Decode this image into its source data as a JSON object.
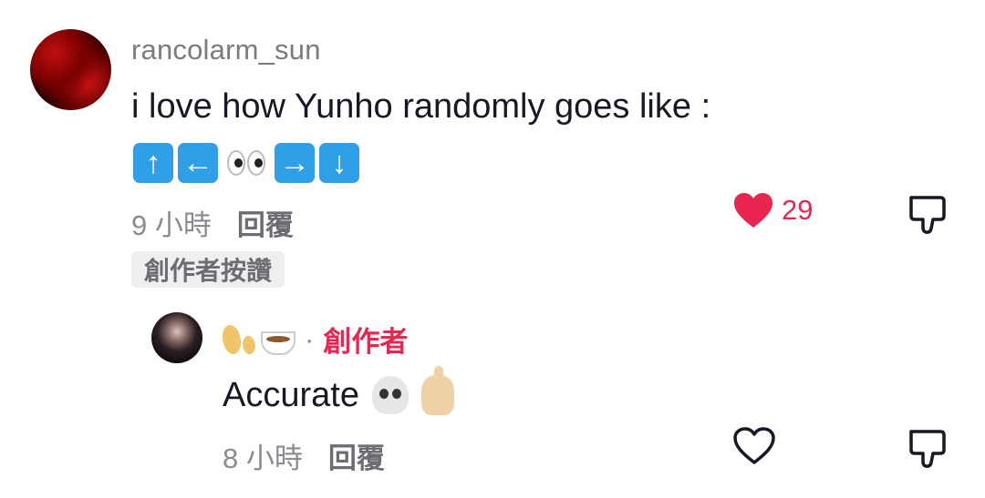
{
  "comment": {
    "username": "rancolarm_sun",
    "text": "i love how Yunho randomly goes like :",
    "emojis": [
      "up-arrow-icon",
      "left-arrow-icon",
      "eyes-icon",
      "right-arrow-icon",
      "down-arrow-icon"
    ],
    "time": "9 小時",
    "reply_label": "回覆",
    "like_count": "29",
    "liked": true,
    "creator_liked_badge": "創作者按讚"
  },
  "reply": {
    "author_emojis": [
      "leaves-icon",
      "coffee-icon"
    ],
    "separator": "·",
    "creator_tag": "創作者",
    "text": "Accurate",
    "text_emojis": [
      "skull-icon",
      "pointing-up-icon"
    ],
    "time": "8 小時",
    "reply_label": "回覆",
    "liked": false
  },
  "colors": {
    "accent": "#e8264f",
    "key_blue": "#2fa0e8",
    "muted_text": "#8a8b91"
  }
}
